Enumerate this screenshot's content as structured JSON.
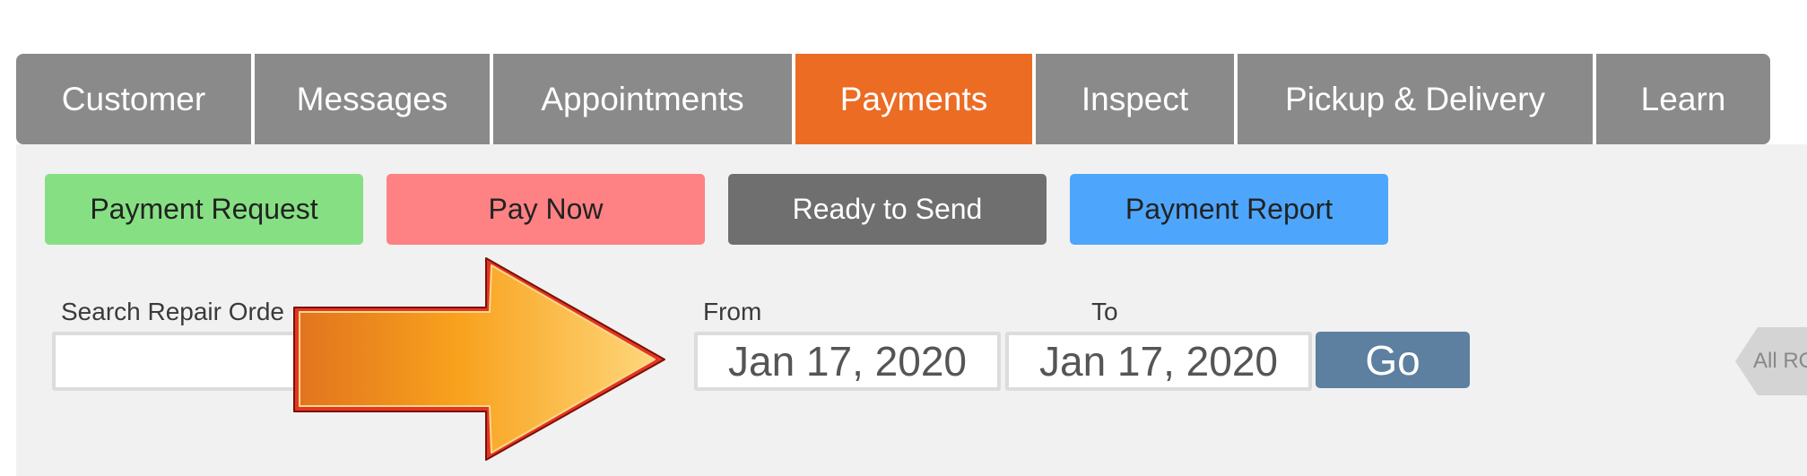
{
  "nav": {
    "tabs": [
      {
        "label": "Customer"
      },
      {
        "label": "Messages"
      },
      {
        "label": "Appointments"
      },
      {
        "label": "Payments"
      },
      {
        "label": "Inspect"
      },
      {
        "label": "Pickup & Delivery"
      },
      {
        "label": "Learn"
      }
    ],
    "active_tab": "Payments"
  },
  "actions": {
    "payment_request": "Payment Request",
    "pay_now": "Pay Now",
    "ready_to_send": "Ready to Send",
    "payment_report": "Payment Report"
  },
  "search": {
    "label": "Search Repair Orde",
    "value": ""
  },
  "date_range": {
    "from_label": "From",
    "from_value": "Jan 17, 2020",
    "to_label": "To",
    "to_value": "Jan 17, 2020",
    "go_label": "Go"
  },
  "all_ro_label": "All RO",
  "colors": {
    "tab_default": "#8a8a8a",
    "tab_active": "#ec6c24",
    "payment_request": "#86e083",
    "pay_now": "#fe8183",
    "ready_to_send": "#6f6f6f",
    "payment_report": "#4da6fb",
    "go_button": "#5d7fa0",
    "panel": "#f1f1f1"
  }
}
